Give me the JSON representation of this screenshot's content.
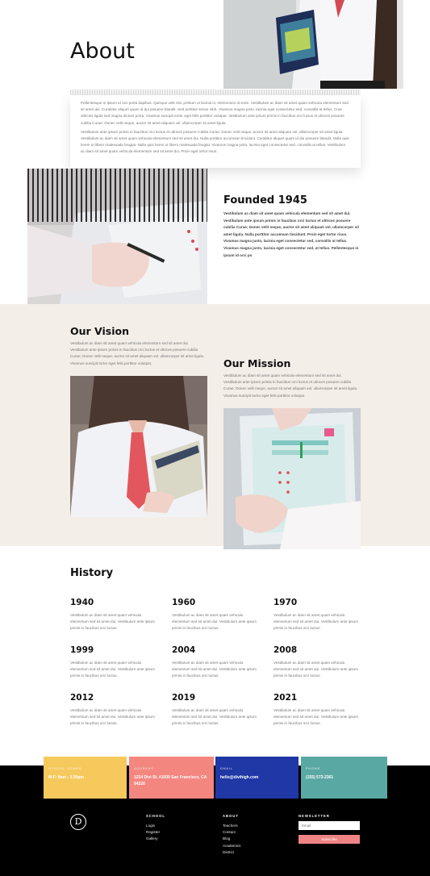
{
  "hero": {
    "title": "About",
    "card_paragraphs": [
      "Pellentesque in ipsum id orci porta dapibus. Quisque velit nisi, pretium ut lacinia in, elementum id enim. Vestibulum ac diam sit amet quam vehicula elementum sed sit amet dui. Curabitur aliquet quam id dui posuere blandit. Sed porttitor lectus nibh. Vivamus magna justo, lacinia eget consectetur sed, convallis at tellus. Cras ultricies ligula sed magna dictum porta. Vivamus suscipit tortor eget felis porttitor volutpat. Vestibulum ante ipsum primis in faucibus orci luctus et ultrices posuere cubilia Curae; Donec velit neque, auctor sit amet aliquam vel, ullamcorper sit amet ligula.",
      "Vestibulum ante ipsum primis in faucibus orci luctus et ultrices posuere cubilia Curae; Donec velit neque, auctor sit amet aliquam vel, ullamcorper sit amet ligula. Vestibulum ac diam sit amet quam vehicula elementum sed sit amet dui. Nulla porttitor accumsan tincidunt. Curabitur aliquet quam id dui posuere blandit. Nulla quis lorem ut libero malesuada feugiat. Nulla quis lorem ut libero malesuada feugiat. Vivamus magna justo, lacinia eget consectetur sed, convallis at tellus. Vestibulum ac diam sit amet quam vehicula elementum sed sit amet dui. Proin eget tortor risus."
    ]
  },
  "founded": {
    "title": "Founded 1945",
    "text": "Vestibulum ac diam sit amet quam vehicula elementum sed sit amet dui. Vestibulum ante ipsum primis in faucibus orci luctus et ultrices posuere cubilia Curae; Donec velit neque, auctor sit amet aliquam vel, ullamcorper sit amet ligula. Nulla porttitor accumsan tincidunt. Proin eget tortor risus. Vivamus magna justo, lacinia eget consectetur sed, convallis at tellus. Vivamus magna justo, lacinia eget consectetur sed, at tellus. Pellentesque in ipsum id orci po"
  },
  "vision": {
    "title": "Our Vision",
    "text": "Vestibulum ac diam sit amet quam vehicula elementum sed sit amet dui. Vestibulum ante ipsum primis in faucibus orci luctus et ultrices posuere cubilia Curae; Donec velit neque, auctor sit amet aliquam vel, ullamcorper sit amet ligula. Vivamus suscipit tortor eget felis porttitor volutpat."
  },
  "mission": {
    "title": "Our Mission",
    "text": "Vestibulum ac diam sit amet quam vehicula elementum sed sit amet dui. Vestibulum ante ipsum primis in faucibus orci luctus et ultrices posuere cubilia Curae; Donec velit neque, auctor sit amet aliquam vel, ullamcorper sit amet ligula. Vivamus suscipit tortor eget felis porttitor volutpat."
  },
  "history": {
    "title": "History",
    "items": [
      {
        "year": "1940",
        "text": "Vestibulum ac diam sit amet quam vehicula elementum sed sit amet dui. Vestibulum ante ipsum primis in faucibus orci luctus."
      },
      {
        "year": "1960",
        "text": "Vestibulum ac diam sit amet quam vehicula elementum sed sit amet dui. Vestibulum ante ipsum primis in faucibus orci luctus."
      },
      {
        "year": "1970",
        "text": "Vestibulum ac diam sit amet quam vehicula elementum sed sit amet dui. Vestibulum ante ipsum primis in faucibus orci luctus."
      },
      {
        "year": "1999",
        "text": "Vestibulum ac diam sit amet quam vehicula elementum sed sit amet dui. Vestibulum ante ipsum primis in faucibus orci luctus."
      },
      {
        "year": "2004",
        "text": "Vestibulum ac diam sit amet quam vehicula elementum sed sit amet dui. Vestibulum ante ipsum primis in faucibus orci luctus."
      },
      {
        "year": "2008",
        "text": "Vestibulum ac diam sit amet quam vehicula elementum sed sit amet dui. Vestibulum ante ipsum primis in faucibus orci luctus."
      },
      {
        "year": "2012",
        "text": "Vestibulum ac diam sit amet quam vehicula elementum sed sit amet dui. Vestibulum ante ipsum primis in faucibus orci luctus."
      },
      {
        "year": "2019",
        "text": "Vestibulum ac diam sit amet quam vehicula elementum sed sit amet dui. Vestibulum ante ipsum primis in faucibus orci luctus."
      },
      {
        "year": "2021",
        "text": "Vestibulum ac diam sit amet quam vehicula elementum sed sit amet dui. Vestibulum ante ipsum primis in faucibus orci luctus."
      }
    ]
  },
  "contact": {
    "hours": {
      "label": "SCHOOL HOURS",
      "value": "M-F: 8am - 3:30pm",
      "color": "#f6c95d"
    },
    "address": {
      "label": "ADDRESS",
      "value": "1234 Divi St. #1000 San Francisco, CA 94220",
      "color": "#f48680"
    },
    "email": {
      "label": "EMAIL",
      "value": "hello@divihigh.com",
      "color": "#2037a6"
    },
    "phone": {
      "label": "PHONE",
      "value": "(155) 573-2361",
      "color": "#5aa8a3"
    }
  },
  "footer": {
    "logo_letter": "D",
    "school": {
      "heading": "SCHOOL",
      "links": [
        "Login",
        "Register",
        "Gallery"
      ]
    },
    "about": {
      "heading": "ABOUT",
      "links": [
        "Teachers",
        "Contact",
        "Blog",
        "Academics",
        "District"
      ]
    },
    "newsletter": {
      "heading": "NEWSLETTER",
      "placeholder": "Email",
      "button": "Subscribe"
    }
  },
  "icons": [
    "divi-logo-icon"
  ]
}
